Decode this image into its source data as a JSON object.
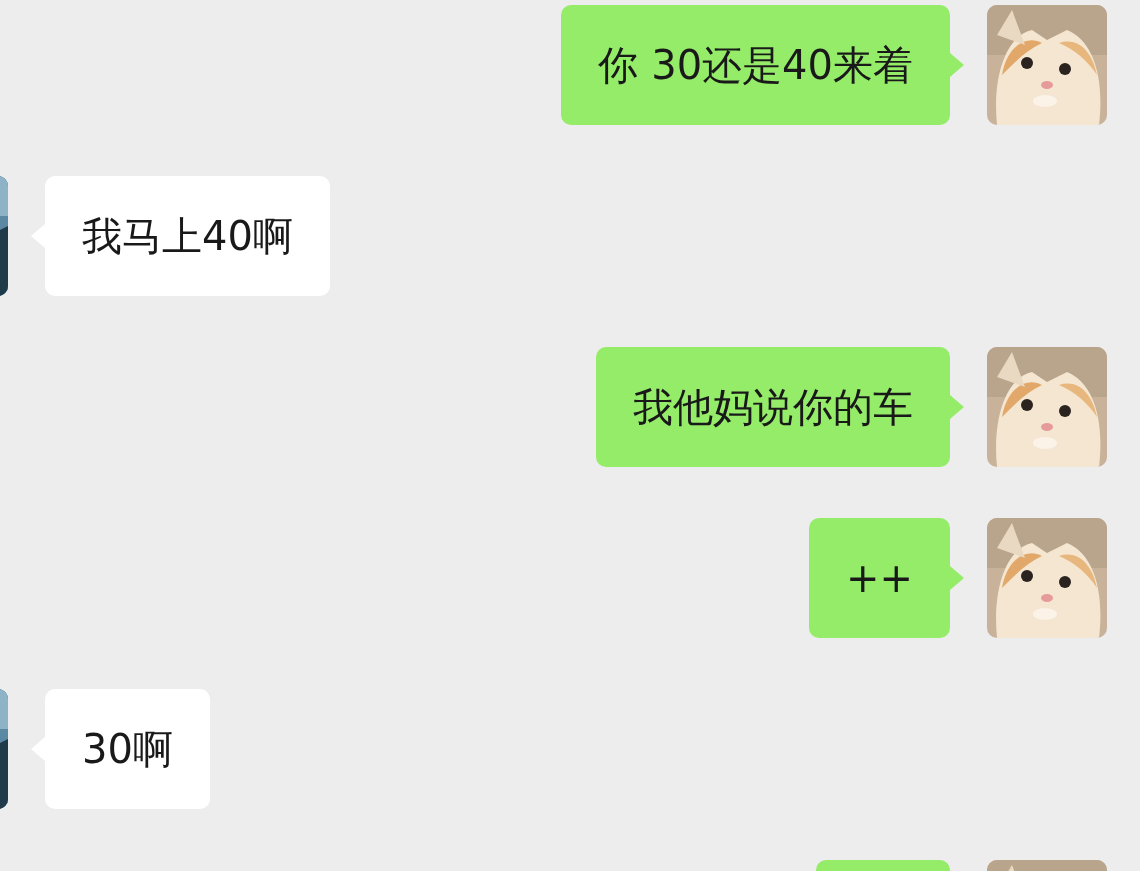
{
  "messages": [
    {
      "kind": "sent",
      "text": "你 30还是40来着"
    },
    {
      "kind": "received",
      "text": "我马上40啊"
    },
    {
      "kind": "sent",
      "text": "我他妈说你的车"
    },
    {
      "kind": "sent",
      "text": "++"
    },
    {
      "kind": "received",
      "text": "30啊"
    },
    {
      "kind": "sent"
    }
  ]
}
